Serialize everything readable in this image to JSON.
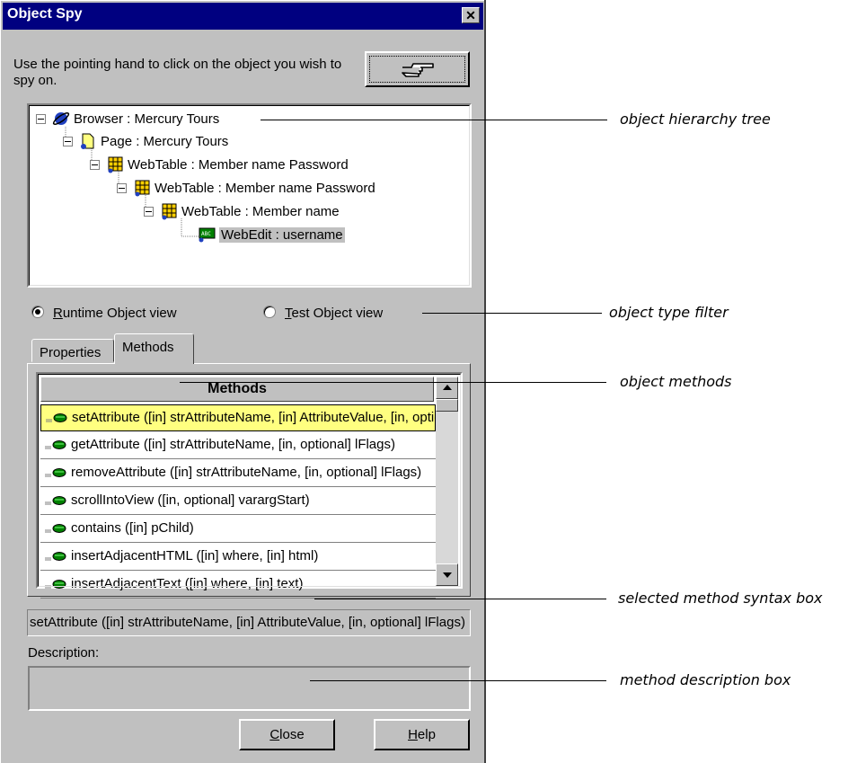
{
  "dialog": {
    "title": "Object Spy",
    "instruction": "Use the pointing hand to click on the object you wish to spy on.",
    "close_x": "✕"
  },
  "tree": {
    "items": [
      {
        "label": "Browser : Mercury Tours",
        "icon": "browser-globe-icon"
      },
      {
        "label": "Page : Mercury Tours",
        "icon": "page-icon"
      },
      {
        "label": "WebTable :  Member name  Password",
        "icon": "webtable-icon"
      },
      {
        "label": "WebTable :  Member name  Password",
        "icon": "webtable-icon"
      },
      {
        "label": "WebTable :  Member name",
        "icon": "webtable-icon"
      },
      {
        "label": "WebEdit : username",
        "icon": "webedit-icon",
        "selected": true
      }
    ]
  },
  "view": {
    "runtime_pre": "",
    "runtime_key": "R",
    "runtime_rest": "untime Object view",
    "test_key": "T",
    "test_rest": "est Object view",
    "selected": "runtime"
  },
  "tabs": {
    "properties": "Properties",
    "methods": "Methods",
    "active": "methods"
  },
  "methods": {
    "header": "Methods",
    "rows": [
      {
        "text": "setAttribute ([in] strAttributeName, [in] AttributeValue, [in, optional] lFlags)",
        "selected": true
      },
      {
        "text": "getAttribute ([in] strAttributeName, [in, optional] lFlags)"
      },
      {
        "text": "removeAttribute ([in] strAttributeName, [in, optional] lFlags)"
      },
      {
        "text": "scrollIntoView ([in, optional] varargStart)"
      },
      {
        "text": "contains ([in] pChild)"
      },
      {
        "text": "insertAdjacentHTML ([in] where, [in] html)"
      },
      {
        "text": "insertAdjacentText ([in] where, [in] text)"
      }
    ]
  },
  "syntax": "setAttribute ([in] strAttributeName, [in] AttributeValue, [in, optional] lFlags)",
  "description_label": "Description:",
  "description_text": "",
  "buttons": {
    "close_key": "C",
    "close_rest": "lose",
    "help_key": "H",
    "help_rest": "elp"
  },
  "callouts": {
    "tree": "object hierarchy tree",
    "filter": "object type filter",
    "methods": "object methods",
    "syntax": "selected method syntax box",
    "description": "method description box"
  },
  "colors": {
    "titlebar": "#000080",
    "dialog_bg": "#c0c0c0",
    "selected_row": "#ffff80"
  }
}
